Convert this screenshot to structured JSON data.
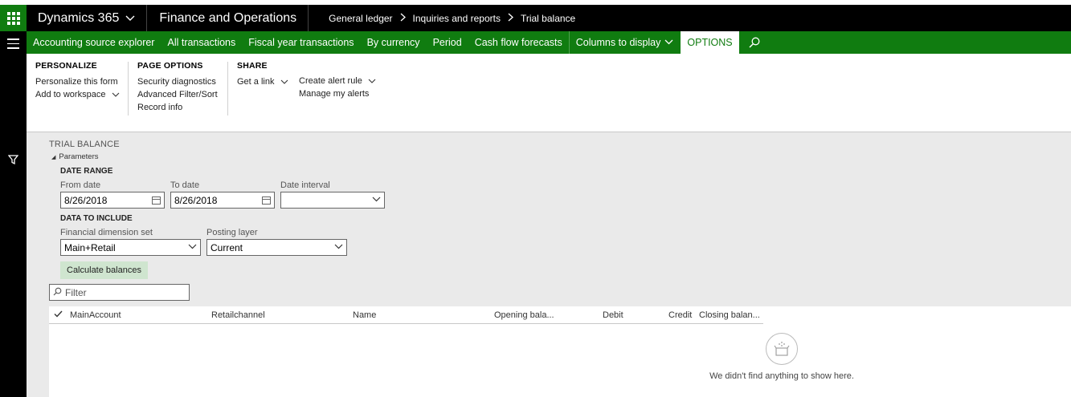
{
  "topbar": {
    "brand": "Dynamics 365",
    "app_name": "Finance and Operations",
    "breadcrumbs": [
      "General ledger",
      "Inquiries and reports",
      "Trial balance"
    ]
  },
  "actionbar": {
    "items": [
      "Accounting source explorer",
      "All transactions",
      "Fiscal year transactions",
      "By currency",
      "Period",
      "Cash flow forecasts",
      "Columns to display",
      "OPTIONS"
    ]
  },
  "ribbon": {
    "personalize": {
      "title": "PERSONALIZE",
      "items": [
        "Personalize this form",
        "Add to workspace"
      ]
    },
    "page_options": {
      "title": "PAGE OPTIONS",
      "items": [
        "Security diagnostics",
        "Advanced Filter/Sort",
        "Record info"
      ]
    },
    "share": {
      "title": "SHARE",
      "get_link": "Get a link",
      "create_alert": "Create alert rule",
      "manage_alerts": "Manage my alerts"
    }
  },
  "form": {
    "title": "TRIAL BALANCE",
    "parameters": "Parameters",
    "date_range": "DATE RANGE",
    "from_date_label": "From date",
    "from_date": "8/26/2018",
    "to_date_label": "To date",
    "to_date": "8/26/2018",
    "interval_label": "Date interval",
    "interval": "",
    "data_to_include": "DATA TO INCLUDE",
    "dimension_label": "Financial dimension set",
    "dimension": "Main+Retail",
    "layer_label": "Posting layer",
    "layer": "Current",
    "calc_button": "Calculate balances",
    "filter_placeholder": "Filter"
  },
  "grid": {
    "columns": [
      "MainAccount",
      "Retailchannel",
      "Name",
      "Opening bala...",
      "Debit",
      "Credit",
      "Closing balan..."
    ],
    "empty_message": "We didn't find anything to show here."
  },
  "colors": {
    "green": "#107c10",
    "black": "#000000",
    "content_bg": "#eaeaea",
    "button_bg": "#cfe5cf"
  },
  "icons": [
    "app-launcher-icon",
    "chevron-down-icon",
    "chevron-right-icon",
    "hamburger-icon",
    "search-icon",
    "filter-icon",
    "calendar-icon",
    "checkmark-icon",
    "empty-box-icon"
  ]
}
